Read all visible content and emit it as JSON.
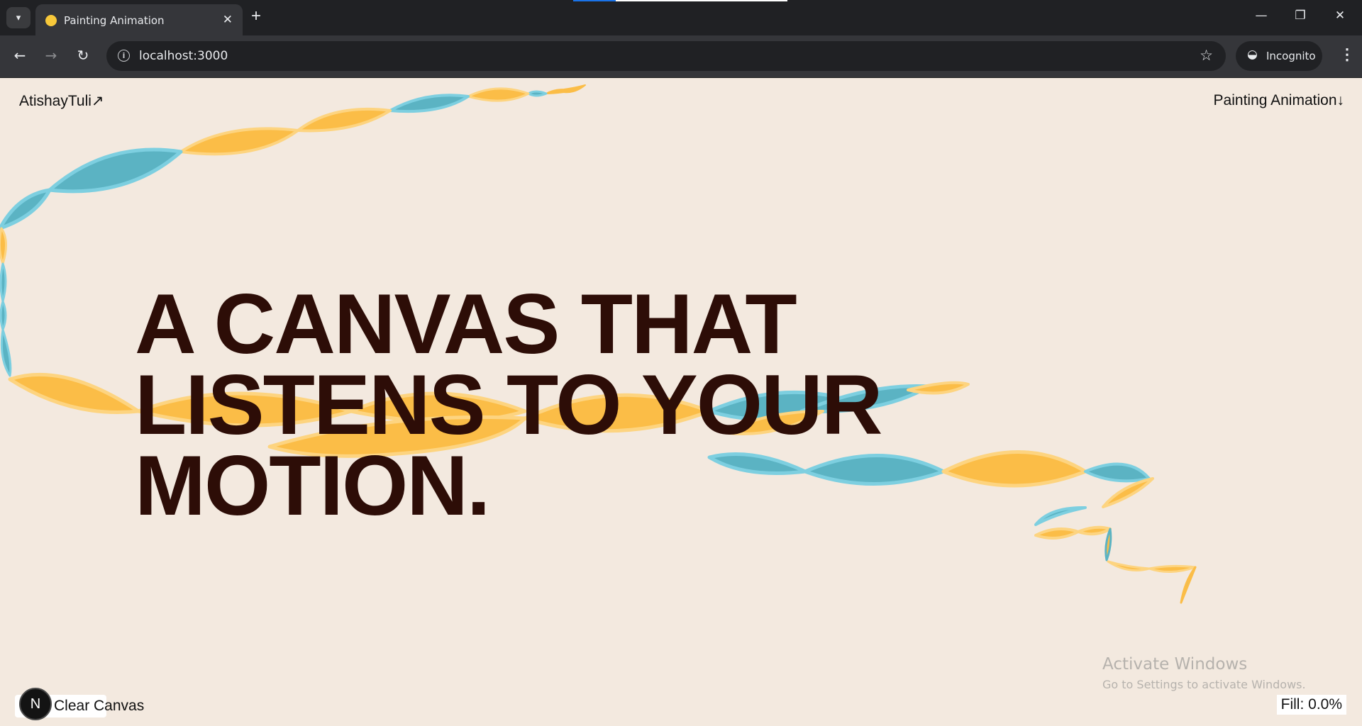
{
  "browser": {
    "tab_title": "Painting Animation",
    "tab_close": "✕",
    "new_tab": "+",
    "url": "localhost:3000",
    "incognito_label": "Incognito",
    "window_controls": [
      "—",
      "❐",
      "✕"
    ],
    "icons": [
      "tab-search-icon",
      "back-icon",
      "forward-icon",
      "reload-icon",
      "info-icon",
      "bookmark-star-icon",
      "incognito-icon",
      "menu-icon"
    ]
  },
  "page": {
    "brand": "AtishayTuli↗",
    "nav_right": "Painting Animation↓",
    "hero_lines": [
      "A CANVAS THAT",
      "LISTENS TO YOUR",
      "MOTION."
    ],
    "clear_label": "Clear Canvas",
    "next_badge": "N",
    "fill_label": "Fill: 0.0%",
    "fill_value": 0.0
  },
  "os_watermark": {
    "title": "Activate Windows",
    "subtitle": "Go to Settings to activate Windows."
  },
  "colors": {
    "background": "#f3e9df",
    "hero_text": "#2d0d07",
    "ribbon_yellow": "#fbbd47",
    "ribbon_blue": "#5bb3c3"
  }
}
